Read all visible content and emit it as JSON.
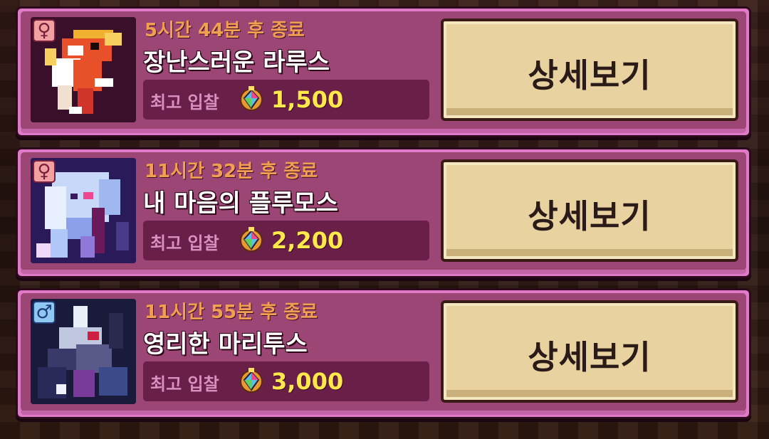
{
  "listings": [
    {
      "gender": "female",
      "gender_symbol": "♀",
      "timer": "5시간 44분 후 종료",
      "name": "장난스러운 라루스",
      "bid_label": "최고 입찰",
      "bid_amount": "1,500",
      "button_label": "상세보기",
      "sprite": "fox-creature-sprite"
    },
    {
      "gender": "female",
      "gender_symbol": "♀",
      "timer": "11시간 32분 후 종료",
      "name": "내 마음의 플루모스",
      "bid_label": "최고 입찰",
      "bid_amount": "2,200",
      "button_label": "상세보기",
      "sprite": "ghost-creature-sprite"
    },
    {
      "gender": "male",
      "gender_symbol": "♂",
      "timer": "11시간 55분 후 종료",
      "name": "영리한 마리투스",
      "bid_label": "최고 입찰",
      "bid_amount": "3,000",
      "button_label": "상세보기",
      "sprite": "dragon-creature-sprite"
    }
  ],
  "colors": {
    "card_border": "#e07ac8",
    "card_fill": "#9c4676",
    "timer": "#f0a050",
    "bid_amount": "#ffe84a",
    "button": "#e8d3a0"
  }
}
